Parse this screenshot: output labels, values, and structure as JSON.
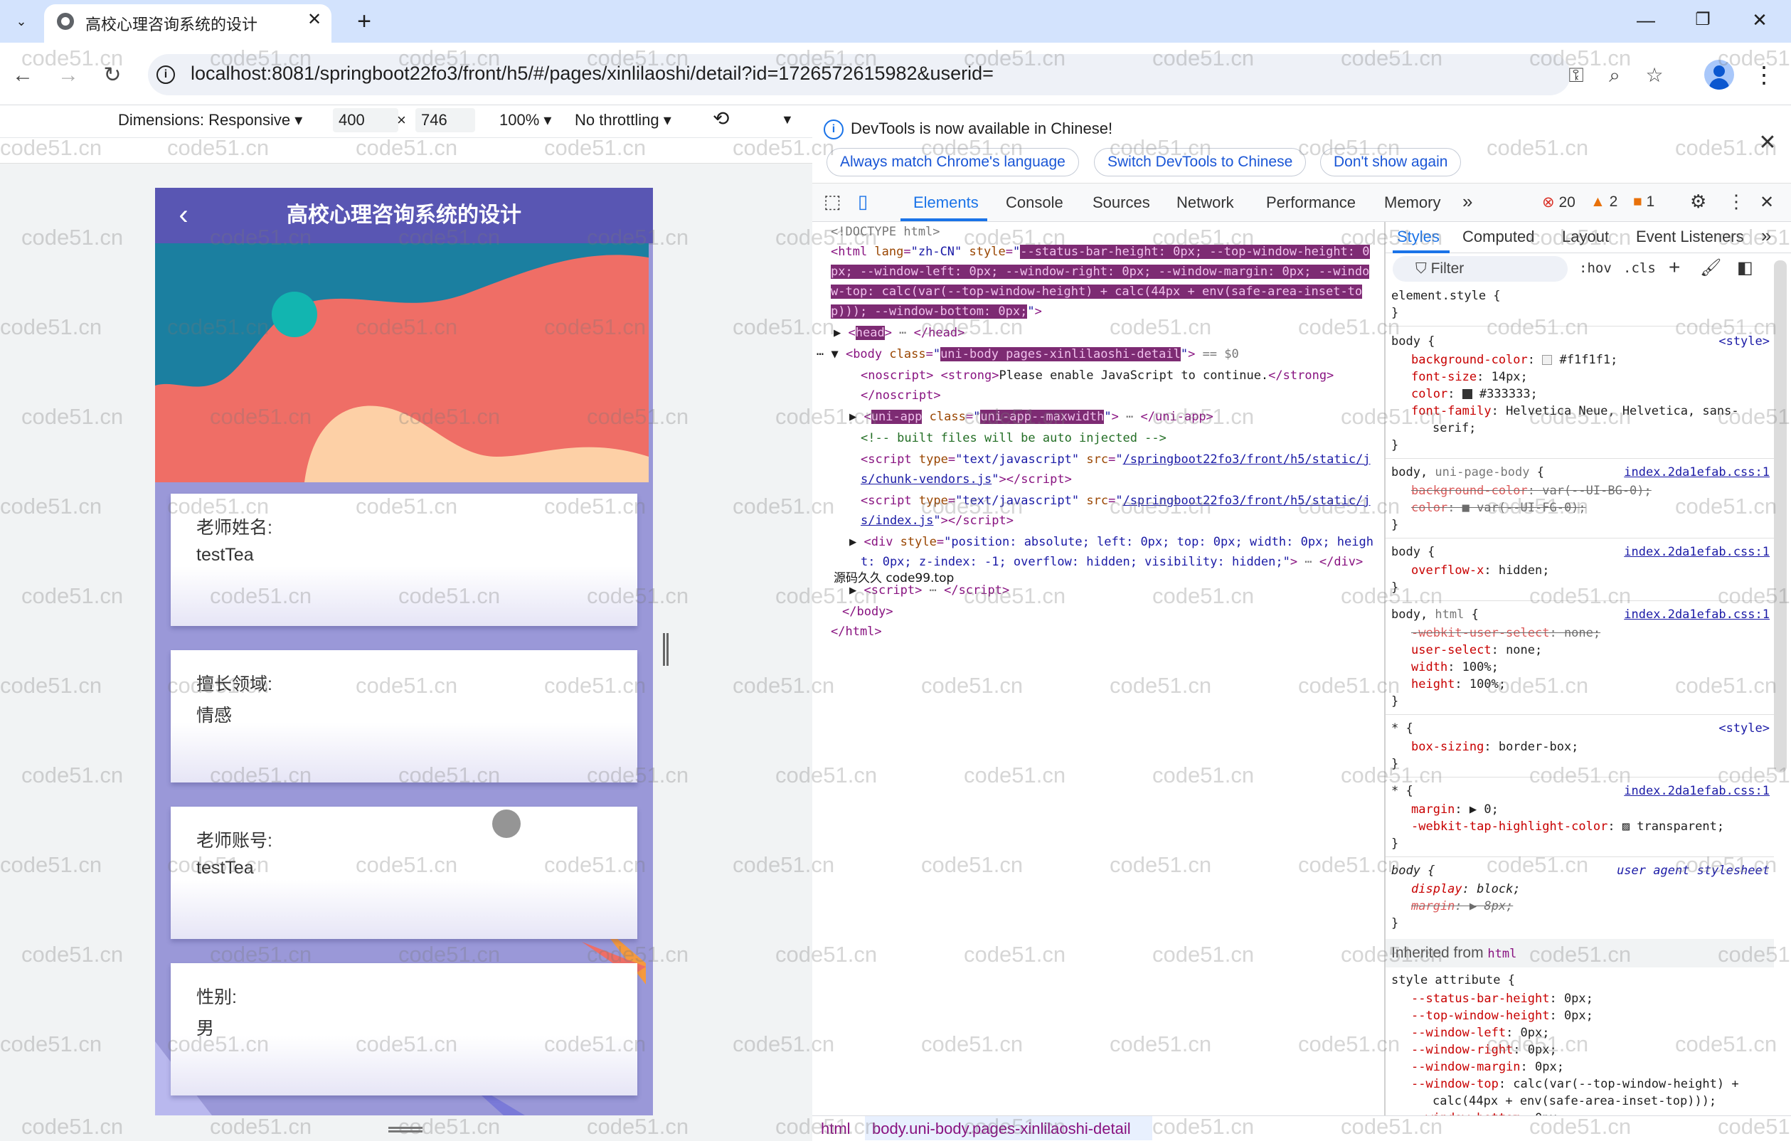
{
  "browser": {
    "tab_title": "高校心理咨询系统的设计",
    "tab_close": "✕",
    "new_tab": "+",
    "url": "localhost:8081/springboot22fo3/front/h5/#/pages/xinlilaoshi/detail?id=1726572615982&userid="
  },
  "device_toolbar": {
    "dimensions": "Dimensions: Responsive ▾",
    "width": "400",
    "times": "×",
    "height": "746",
    "zoom": "100% ▾",
    "throttling": "No throttling ▾"
  },
  "app": {
    "title": "高校心理咨询系统的设计",
    "back": "‹",
    "fields": [
      {
        "label": "老师姓名:",
        "value": "testTea"
      },
      {
        "label": "擅长领域:",
        "value": "情感"
      },
      {
        "label": "老师账号:",
        "value": "testTea"
      },
      {
        "label": "性别:",
        "value": "男"
      }
    ]
  },
  "devtools": {
    "infobar_message": "DevTools is now available in Chinese!",
    "infobar_buttons": [
      "Always match Chrome's language",
      "Switch DevTools to Chinese",
      "Don't show again"
    ],
    "tabs": [
      "Elements",
      "Console",
      "Sources",
      "Network",
      "Performance",
      "Memory",
      "»"
    ],
    "errors": "20",
    "warnings": "2",
    "issues": "1",
    "styles_tabs": [
      "Styles",
      "Computed",
      "Layout",
      "Event Listeners",
      "»"
    ],
    "filter_placeholder": "Filter",
    "hov": ":hov",
    "cls": ".cls",
    "breadcrumb": [
      "html",
      "body.uni-body.pages-xinlilaoshi-detail"
    ],
    "inherited_from": "Inherited from",
    "overlay_text": "源码久久 code99.top"
  },
  "watermark": "code51.cn",
  "colors": {
    "header": "#5956b3",
    "page_bg": "#9a98d8",
    "banner_red": "#ef6e66",
    "wave_teal": "#1b7fa0",
    "accent": "#1a73e8"
  }
}
